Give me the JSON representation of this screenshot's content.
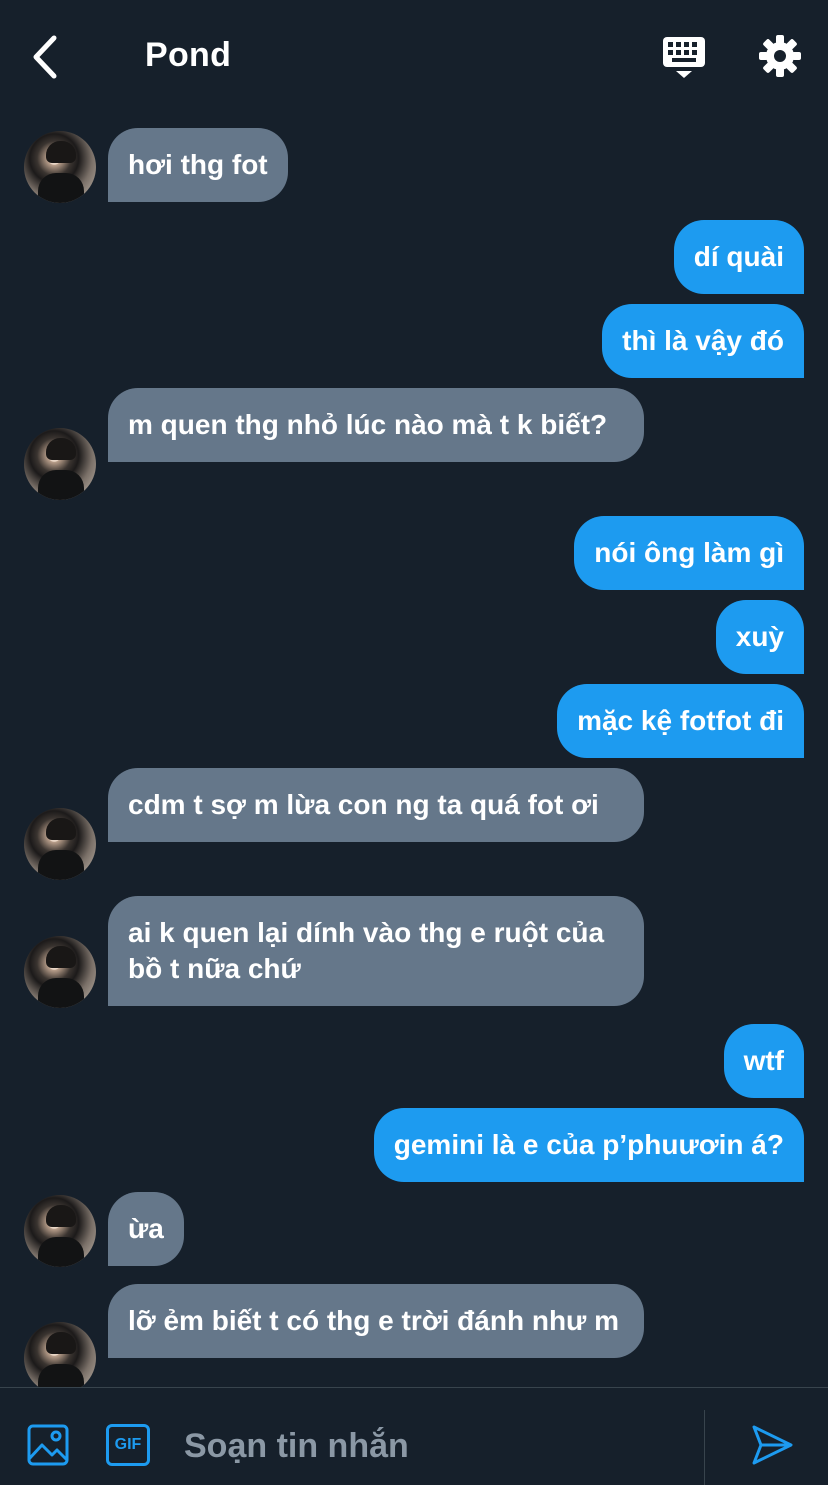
{
  "header": {
    "title": "Pond",
    "back_icon": "chevron-left-icon",
    "keyboard_icon": "keyboard-icon",
    "settings_icon": "gear-icon"
  },
  "messages": [
    {
      "side": "in",
      "text": "hơi thg fot"
    },
    {
      "side": "out",
      "text": "dí quài"
    },
    {
      "side": "out",
      "text": "thì là vậy đó"
    },
    {
      "side": "in",
      "text": "m quen thg nhỏ lúc nào mà t k biết?"
    },
    {
      "side": "out",
      "text": "nói ông làm gì"
    },
    {
      "side": "out",
      "text": "xuỳ"
    },
    {
      "side": "out",
      "text": "mặc kệ fotfot đi"
    },
    {
      "side": "in",
      "text": "cdm t sợ m lừa con ng ta quá fot ơi"
    },
    {
      "side": "in",
      "text": "ai k quen lại dính vào thg e ruột của bồ t nữa chứ"
    },
    {
      "side": "out",
      "text": "wtf"
    },
    {
      "side": "out",
      "text": "gemini là e của p’phuươin á?"
    },
    {
      "side": "in",
      "text": "ừa"
    },
    {
      "side": "in",
      "text": "lỡ ẻm biết t có thg e trời đánh như m"
    }
  ],
  "composer": {
    "placeholder": "Soạn tin nhắn",
    "gif_label": "GIF",
    "image_icon": "image-icon",
    "send_icon": "send-icon"
  },
  "colors": {
    "background": "#16202b",
    "incoming_bubble": "#65778a",
    "outgoing_bubble": "#1d9bf0",
    "accent": "#1d9bf0",
    "placeholder": "#8b98a5"
  }
}
